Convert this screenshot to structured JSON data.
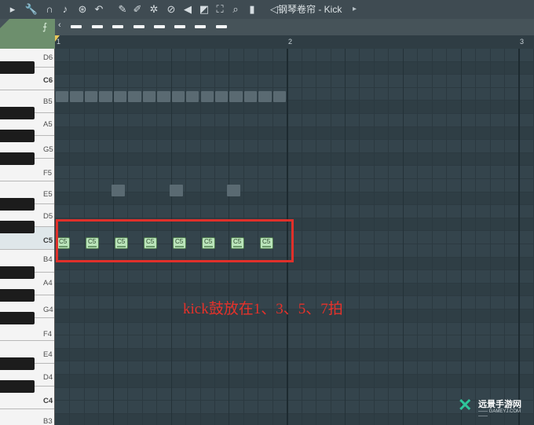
{
  "toolbar": {
    "icons": [
      {
        "name": "play-triangle-icon",
        "glyph": "▸"
      },
      {
        "name": "wrench-icon",
        "glyph": "🔧"
      },
      {
        "name": "magnet-icon",
        "glyph": "∩"
      },
      {
        "name": "note-icon",
        "glyph": "♪"
      },
      {
        "name": "stop-circle-icon",
        "glyph": "⊛"
      },
      {
        "name": "undo-icon",
        "glyph": "↶"
      },
      {
        "name": "pencil-icon",
        "glyph": "✎"
      },
      {
        "name": "paint-icon",
        "glyph": "✐"
      },
      {
        "name": "magic-icon",
        "glyph": "✲"
      },
      {
        "name": "delete-icon",
        "glyph": "⊘"
      },
      {
        "name": "mute-icon",
        "glyph": "◀"
      },
      {
        "name": "slice-icon",
        "glyph": "◩"
      },
      {
        "name": "select-icon",
        "glyph": "⛶"
      },
      {
        "name": "zoom-icon",
        "glyph": "⌕"
      },
      {
        "name": "playback-icon",
        "glyph": "▮"
      },
      {
        "name": "speaker-icon",
        "glyph": "◁"
      }
    ],
    "title": "钢琴卷帘 - Kick",
    "title_arrow": "▸"
  },
  "tool_tab_glyph": "⨍",
  "left_arrow": "‹",
  "ruler": {
    "marks": [
      "1",
      "2",
      "3"
    ]
  },
  "piano_keys": {
    "labels": [
      "D6",
      "C6",
      "B5",
      "A5",
      "G5",
      "F5",
      "E5",
      "D5",
      "C5",
      "B4",
      "A4",
      "G4",
      "F4",
      "E4",
      "D4",
      "C4",
      "B3"
    ]
  },
  "notes": {
    "label": "C5",
    "count": 8,
    "note_name": "C5"
  },
  "ghost_notes": {
    "rows": [
      "B5",
      "E5"
    ]
  },
  "annotation": "kick鼓放在1、3、5、7拍",
  "colors": {
    "highlight": "#e0302a",
    "note_fill": "#b9e3b9",
    "grid_bg": "#34444c"
  },
  "watermark": {
    "logo": "✕",
    "title": "远景手游网",
    "subtitle": "—— GAMEYJ.COM ——"
  }
}
